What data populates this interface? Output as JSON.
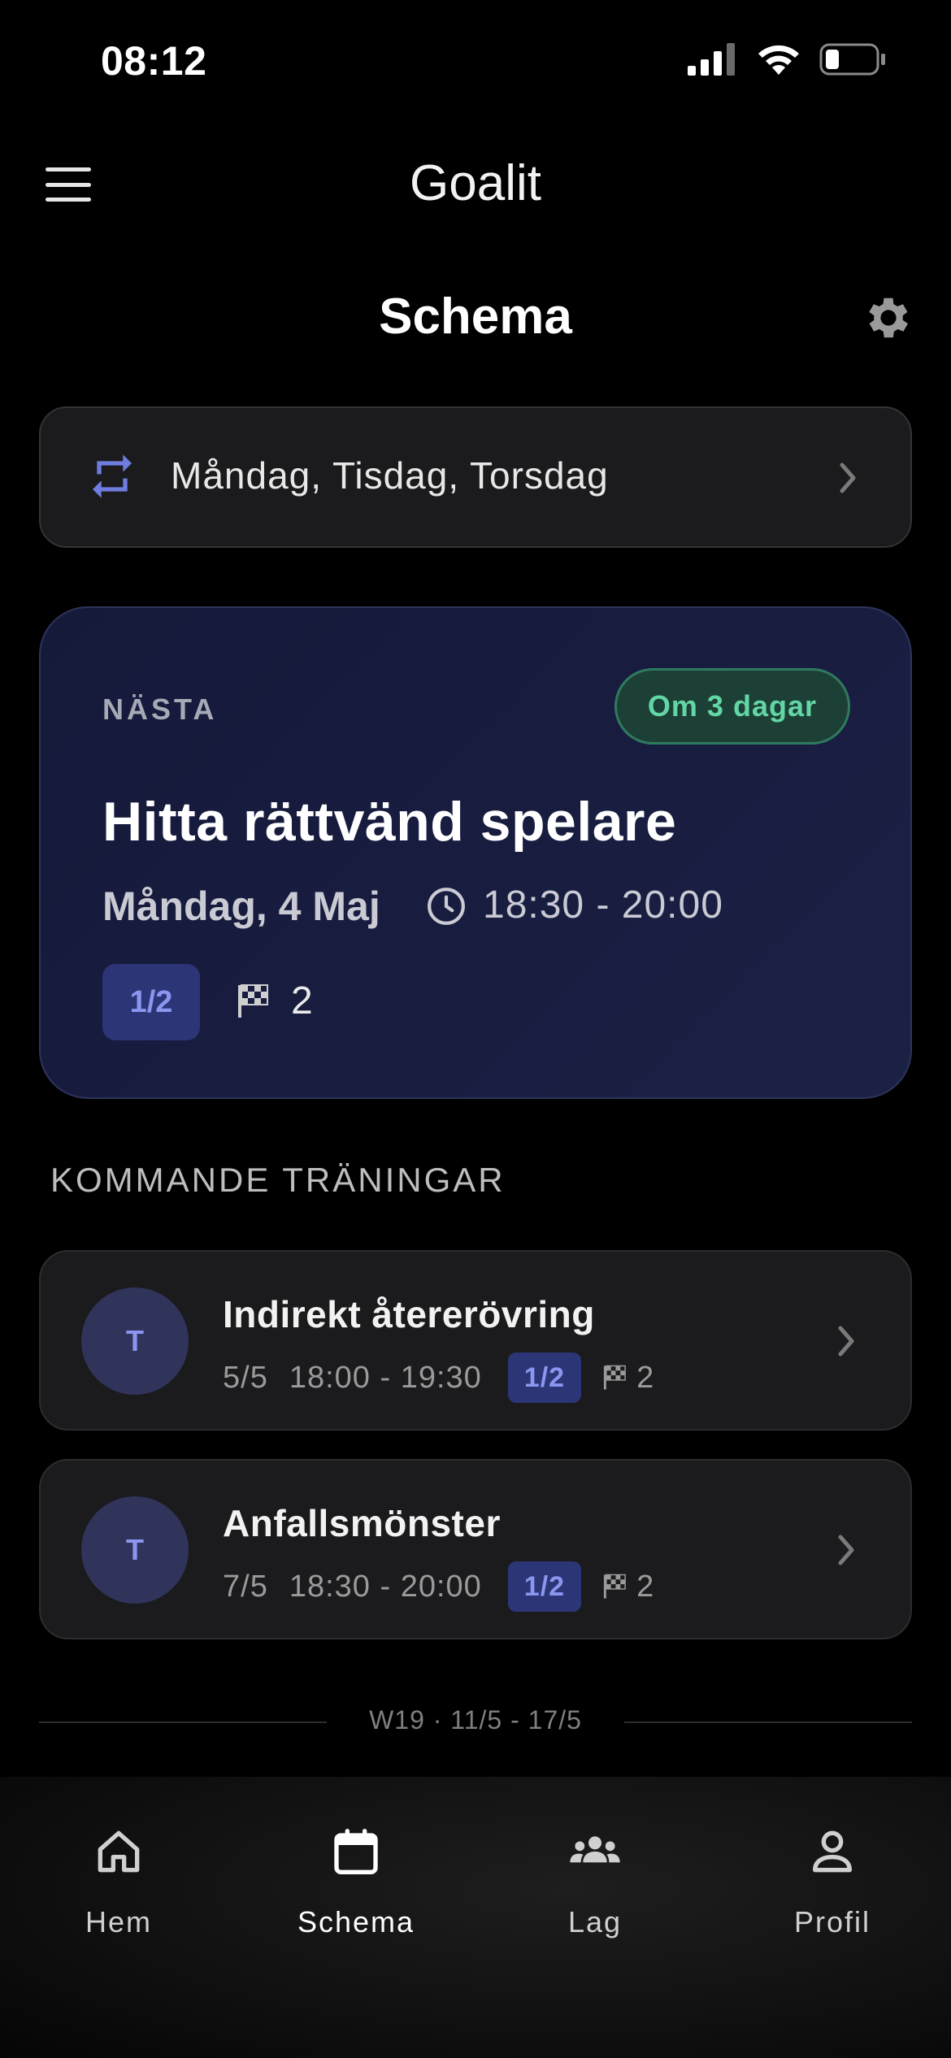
{
  "status_bar": {
    "time": "08:12"
  },
  "app_bar": {
    "title": "Goalit"
  },
  "page": {
    "title": "Schema"
  },
  "recurrence": {
    "days": "Måndag, Tisdag, Torsdag"
  },
  "next": {
    "label": "NÄSTA",
    "badge": "Om 3 dagar",
    "title": "Hitta rättvänd spelare",
    "date": "Måndag, 4 Maj",
    "time": "18:30 - 20:00",
    "level": "1/2",
    "flag_count": "2"
  },
  "upcoming": {
    "header": "KOMMANDE TRÄNINGAR",
    "items": [
      {
        "avatar": "T",
        "title": "Indirekt återerövring",
        "date": "5/5",
        "time": "18:00 - 19:30",
        "level": "1/2",
        "flag_count": "2"
      },
      {
        "avatar": "T",
        "title": "Anfallsmönster",
        "date": "7/5",
        "time": "18:30 - 20:00",
        "level": "1/2",
        "flag_count": "2"
      }
    ]
  },
  "week_divider": "W19 · 11/5 - 17/5",
  "nav": {
    "items": [
      {
        "label": "Hem",
        "icon": "home-icon"
      },
      {
        "label": "Schema",
        "icon": "calendar-icon"
      },
      {
        "label": "Lag",
        "icon": "team-icon"
      },
      {
        "label": "Profil",
        "icon": "person-icon"
      }
    ],
    "active": "Schema"
  },
  "colors": {
    "accent": "#8a96f0",
    "badge_green": "#62d6a5",
    "card_bg": "#1b1b1d",
    "next_card_bg": "#15193a"
  }
}
